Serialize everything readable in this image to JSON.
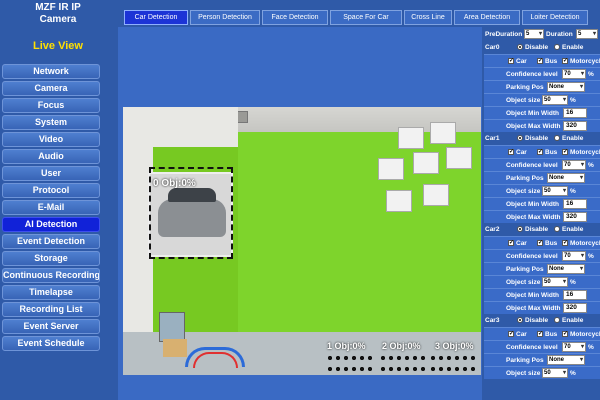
{
  "brand": {
    "line1": "MZF IR IP",
    "line2": "Camera"
  },
  "live_view": "Live View",
  "nav": [
    {
      "label": "Network",
      "active": false
    },
    {
      "label": "Camera",
      "active": false
    },
    {
      "label": "Focus",
      "active": false
    },
    {
      "label": "System",
      "active": false
    },
    {
      "label": "Video",
      "active": false
    },
    {
      "label": "Audio",
      "active": false
    },
    {
      "label": "User",
      "active": false
    },
    {
      "label": "Protocol",
      "active": false
    },
    {
      "label": "E-Mail",
      "active": false
    },
    {
      "label": "AI Detection",
      "active": true
    },
    {
      "label": "Event Detection",
      "active": false
    },
    {
      "label": "Storage",
      "active": false
    },
    {
      "label": "Continuous Recording",
      "active": false
    },
    {
      "label": "Timelapse",
      "active": false
    },
    {
      "label": "Recording List",
      "active": false
    },
    {
      "label": "Event Server",
      "active": false
    },
    {
      "label": "Event Schedule",
      "active": false
    }
  ],
  "tabs": [
    {
      "label": "Car Detection",
      "active": true
    },
    {
      "label": "Person Detection",
      "active": false
    },
    {
      "label": "Face Detection",
      "active": false
    },
    {
      "label": "Space For Car",
      "active": false
    },
    {
      "label": "Cross Line",
      "active": false
    },
    {
      "label": "Area Detection",
      "active": false
    },
    {
      "label": "Loiter Detection",
      "active": false
    }
  ],
  "video": {
    "detection_label": "0 Obj:0%",
    "zones": [
      "1 Obj:0%",
      "2 Obj:0%",
      "3 Obj:0%"
    ]
  },
  "panel": {
    "pre_duration_label": "PreDuration",
    "pre_duration_value": "5",
    "duration_label": "Duration",
    "duration_value": "5",
    "cars": [
      {
        "name": "Car0",
        "disable": "Disable",
        "enable": "Enable",
        "state": "disable",
        "types": [
          "Car",
          "Bus",
          "Motorcycle"
        ],
        "confidence_label": "Confidence level",
        "confidence": "70",
        "unit": "%",
        "parking_label": "Parking Pos",
        "parking": "None",
        "size_label": "Object size",
        "size": "50",
        "min_label": "Object Min Width",
        "min": "16",
        "max_label": "Object Max Width",
        "max": "320"
      },
      {
        "name": "Car1",
        "disable": "Disable",
        "enable": "Enable",
        "state": "disable",
        "types": [
          "Car",
          "Bus",
          "Motorcycle"
        ],
        "confidence_label": "Confidence level",
        "confidence": "70",
        "unit": "%",
        "parking_label": "Parking Pos",
        "parking": "None",
        "size_label": "Object size",
        "size": "50",
        "min_label": "Object Min Width",
        "min": "16",
        "max_label": "Object Max Width",
        "max": "320"
      },
      {
        "name": "Car2",
        "disable": "Disable",
        "enable": "Enable",
        "state": "disable",
        "types": [
          "Car",
          "Bus",
          "Motorcycle"
        ],
        "confidence_label": "Confidence level",
        "confidence": "70",
        "unit": "%",
        "parking_label": "Parking Pos",
        "parking": "None",
        "size_label": "Object size",
        "size": "50",
        "min_label": "Object Min Width",
        "min": "16",
        "max_label": "Object Max Width",
        "max": "320"
      },
      {
        "name": "Car3",
        "disable": "Disable",
        "enable": "Enable",
        "state": "disable",
        "types": [
          "Car",
          "Bus",
          "Motorcycle"
        ],
        "confidence_label": "Confidence level",
        "confidence": "70",
        "unit": "%",
        "parking_label": "Parking Pos",
        "parking": "None",
        "size_label": "Object size",
        "size": "50"
      }
    ]
  }
}
